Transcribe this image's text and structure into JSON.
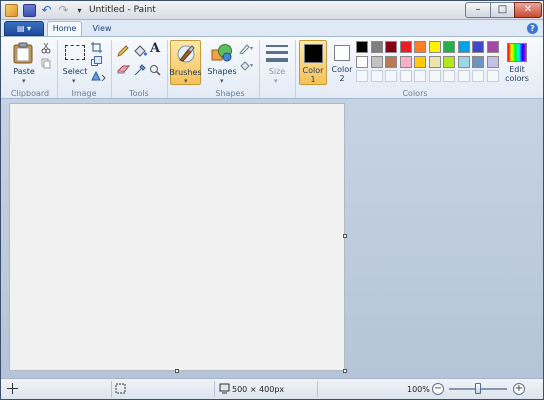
{
  "window": {
    "title": "Untitled - Paint",
    "min": "–",
    "max": "□",
    "close": "✕"
  },
  "quick_access": {
    "undo": "↶",
    "redo": "↷",
    "customize": "▾"
  },
  "tabs": {
    "app_menu": "▤ ▾",
    "home": "Home",
    "view": "View",
    "help": "?"
  },
  "ribbon": {
    "clipboard": {
      "paste": "Paste",
      "group": "Clipboard"
    },
    "image": {
      "select": "Select",
      "group": "Image"
    },
    "tools": {
      "text_glyph": "A",
      "group": "Tools"
    },
    "brushes": {
      "label": "Brushes"
    },
    "shapes": {
      "label": "Shapes",
      "group": "Shapes"
    },
    "size": {
      "label": "Size"
    },
    "color1": {
      "label1": "Color",
      "label2": "1"
    },
    "color2": {
      "label1": "Color",
      "label2": "2"
    },
    "colors": {
      "group": "Colors",
      "edit1": "Edit",
      "edit2": "colors"
    }
  },
  "palette_row1": [
    "#000000",
    "#7f7f7f",
    "#880015",
    "#ed1c24",
    "#ff7f27",
    "#fff200",
    "#22b14c",
    "#00a2e8",
    "#3f48cc",
    "#a349a4"
  ],
  "palette_row2": [
    "#ffffff",
    "#c3c3c3",
    "#b97a57",
    "#ffaec9",
    "#ffc90e",
    "#efe4b0",
    "#b5e61d",
    "#99d9ea",
    "#7092be",
    "#c8bfe7"
  ],
  "palette_row3_count": 10,
  "status": {
    "dimensions": "500 × 400px",
    "zoom": "100%",
    "zoom_out": "−",
    "zoom_in": "+"
  }
}
